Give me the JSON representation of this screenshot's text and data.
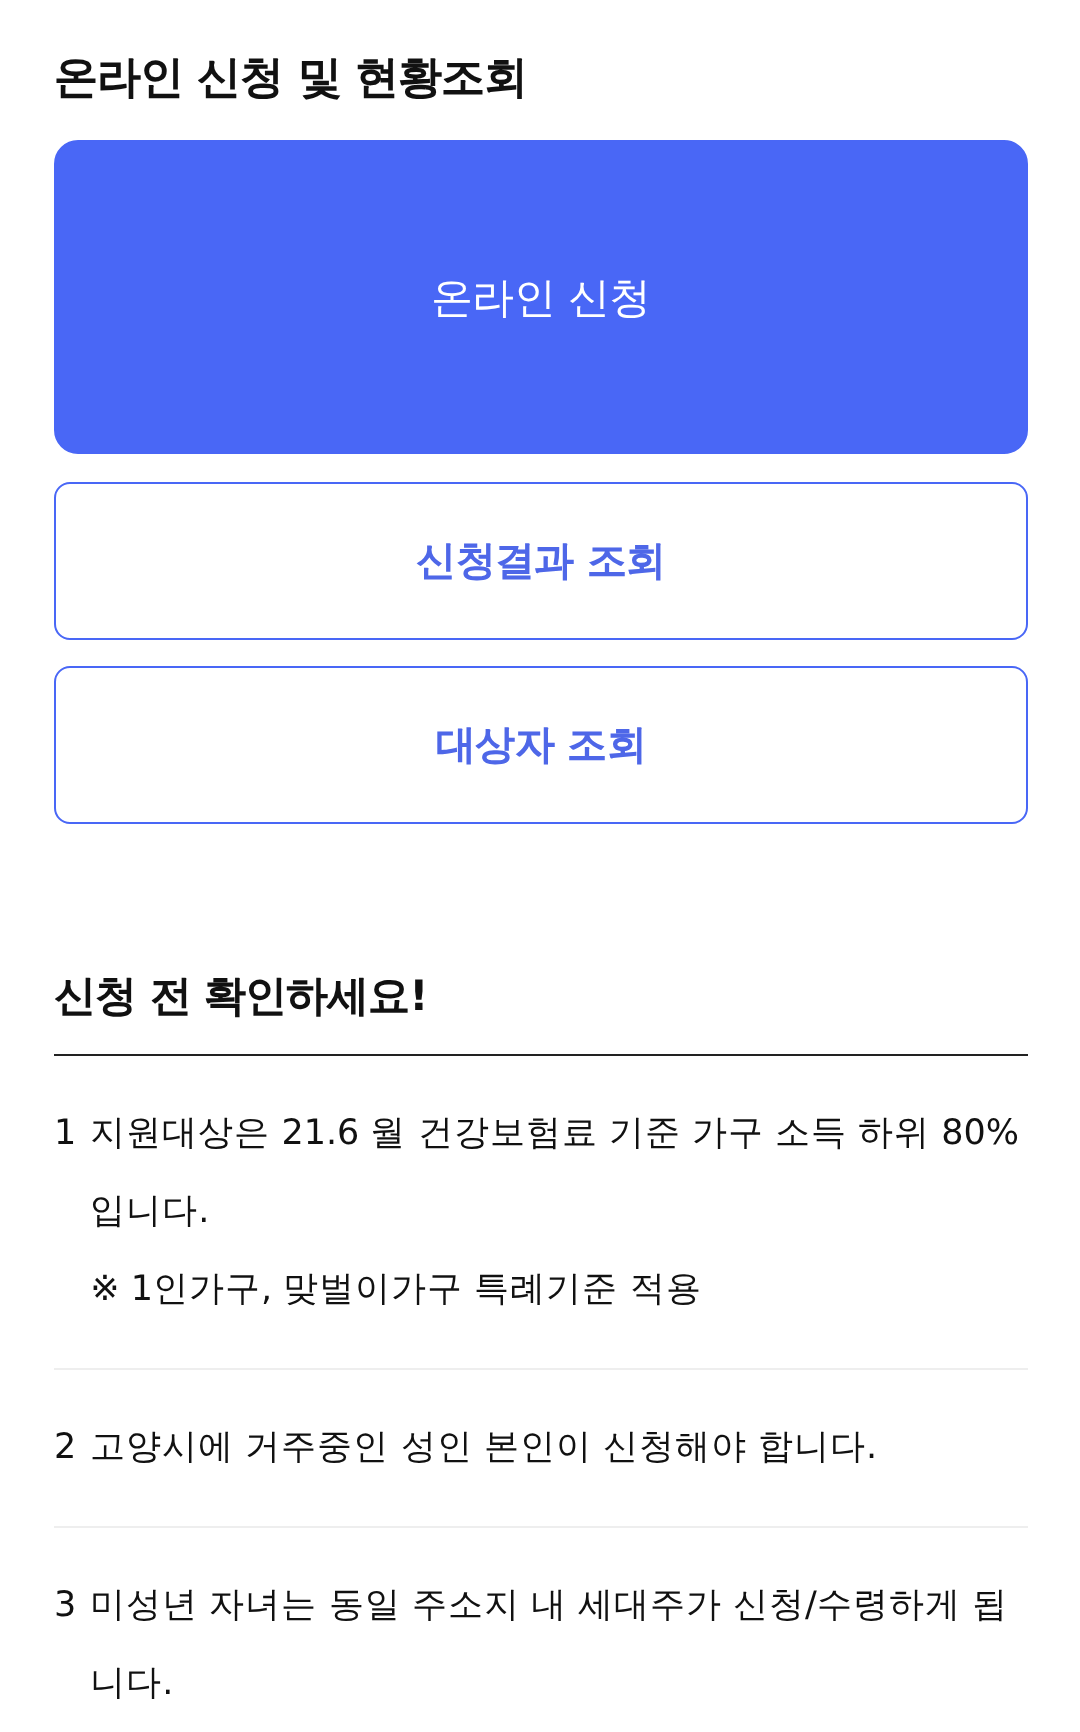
{
  "title": "온라인 신청 및 현황조회",
  "buttons": [
    {
      "label": "온라인 신청",
      "kind": "primary"
    },
    {
      "label": "신청결과 조회",
      "kind": "outline"
    },
    {
      "label": "대상자 조회",
      "kind": "outline"
    }
  ],
  "notice": {
    "title": "신청 전 확인하세요!",
    "items": [
      {
        "number": "1",
        "text": "지원대상은 21.6 월 건강보험료 기준 가구 소득 하위 80%입니다.",
        "note": "※ 1인가구, 맞벌이가구 특례기준 적용"
      },
      {
        "number": "2",
        "text": "고양시에 거주중인 성인 본인이 신청해야 합니다."
      },
      {
        "number": "3",
        "text": "미성년 자녀는 동일 주소지 내 세대주가 신청/수령하게 됩니다."
      }
    ]
  }
}
